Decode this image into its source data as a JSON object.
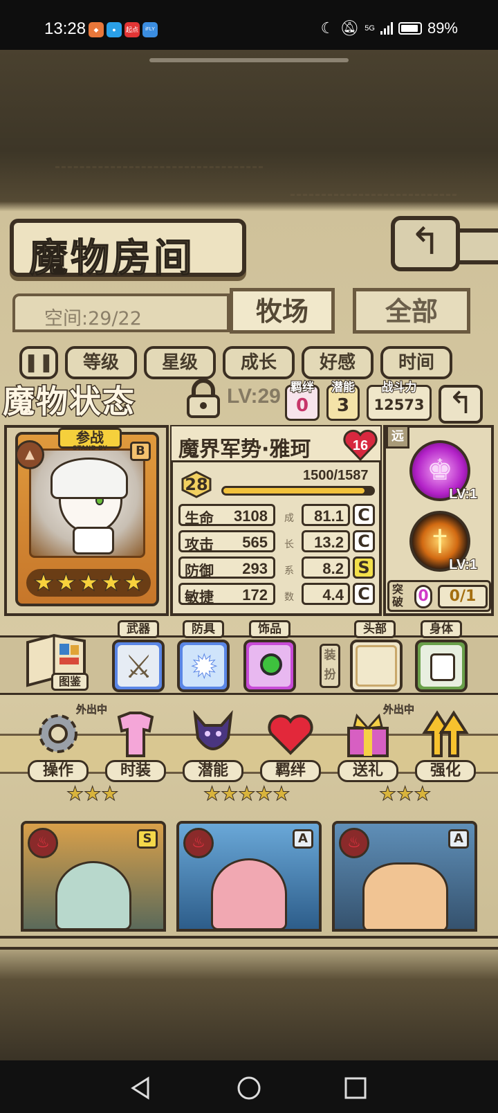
{
  "status_bar": {
    "time": "13:28",
    "app_icons": [
      {
        "icon": "shield-app-icon",
        "color": "#e8773a"
      },
      {
        "icon": "chat-app-icon",
        "color": "#2aa0e8"
      },
      {
        "icon": "qidian-app-icon",
        "text": "起点",
        "color": "#e23535"
      },
      {
        "icon": "ifly-app-icon",
        "text": "iFLY",
        "color": "#3b8de0"
      }
    ],
    "network": "5G",
    "battery": "89%"
  },
  "header": {
    "title": "魔物房间",
    "back_icon": "return-arrow-icon"
  },
  "room": {
    "space_label": "空间:29/22",
    "tabs": [
      {
        "label": "牧场",
        "active": true
      },
      {
        "label": "全部",
        "active": false
      }
    ],
    "filters": [
      "等级",
      "星级",
      "成长",
      "好感",
      "时间"
    ],
    "sort_icon": "pause-sort-icon"
  },
  "status_panel": {
    "title": "魔物状态",
    "lock_icon": "padlock-icon",
    "lv_label": "LV:29",
    "bond": {
      "label": "羁绊",
      "value": "0"
    },
    "potential": {
      "label": "潜能",
      "value": "3"
    },
    "power": {
      "label": "战斗力",
      "value": "12573"
    },
    "back_icon": "return-arrow-icon"
  },
  "monster": {
    "card_badge": "参战",
    "card_badge_sub": "STAND BY",
    "rank": "B",
    "stars": 5,
    "name": "魔界军势·雅珂",
    "affection": "16",
    "level": "28",
    "xp_text": "1500/1587",
    "xp_fraction": 0.945,
    "stats": [
      {
        "label": "生命",
        "value": "3108",
        "growth": "81.1",
        "grade": "C"
      },
      {
        "label": "攻击",
        "value": "565",
        "growth": "13.2",
        "grade": "C"
      },
      {
        "label": "防御",
        "value": "293",
        "growth": "8.2",
        "grade": "S"
      },
      {
        "label": "敏捷",
        "value": "172",
        "growth": "4.4",
        "grade": "C"
      }
    ],
    "growth_label": [
      "成",
      "长",
      "系",
      "数"
    ],
    "range": "远",
    "skills": [
      {
        "icon": "chess-king-skill-icon",
        "level": "LV:1",
        "color": "#c23bd6"
      },
      {
        "icon": "fire-sword-skill-icon",
        "level": "LV:1",
        "color": "#d96b12"
      }
    ],
    "breakthrough": {
      "label": "突破",
      "count": "0",
      "progress": "0/1"
    }
  },
  "equipment": {
    "book_label": "图鉴",
    "book_icon": "encyclopedia-book-icon",
    "slots": [
      {
        "label": "武器",
        "icon": "sword-icon",
        "filled": true
      },
      {
        "label": "防具",
        "icon": "ice-crystal-armor-icon",
        "filled": true
      },
      {
        "label": "饰品",
        "icon": "eye-accessory-icon",
        "filled": true
      }
    ],
    "dress_label": "装扮",
    "cosmetic_slots": [
      {
        "label": "头部",
        "icon": "empty-slot-icon",
        "filled": false
      },
      {
        "label": "身体",
        "icon": "maid-apron-icon",
        "filled": true
      }
    ]
  },
  "actions": [
    {
      "label": "操作",
      "icon": "gear-icon"
    },
    {
      "label": "时装",
      "icon": "outfit-icon"
    },
    {
      "label": "潜能",
      "icon": "shadow-demon-icon"
    },
    {
      "label": "羁绊",
      "icon": "hearts-icon"
    },
    {
      "label": "送礼",
      "icon": "gift-icon"
    },
    {
      "label": "强化",
      "icon": "upgrade-arrows-icon"
    }
  ],
  "background_cards": {
    "outing_labels": [
      "外出中",
      "外出中"
    ],
    "cards": [
      {
        "rank": "S",
        "icon": "fire-element-icon"
      },
      {
        "rank": "A",
        "icon": "fire-element-icon"
      },
      {
        "rank": "A",
        "icon": "fire-element-icon"
      }
    ]
  },
  "navbar": {
    "back": "back-triangle-icon",
    "home": "home-circle-icon",
    "recents": "recents-square-icon"
  }
}
